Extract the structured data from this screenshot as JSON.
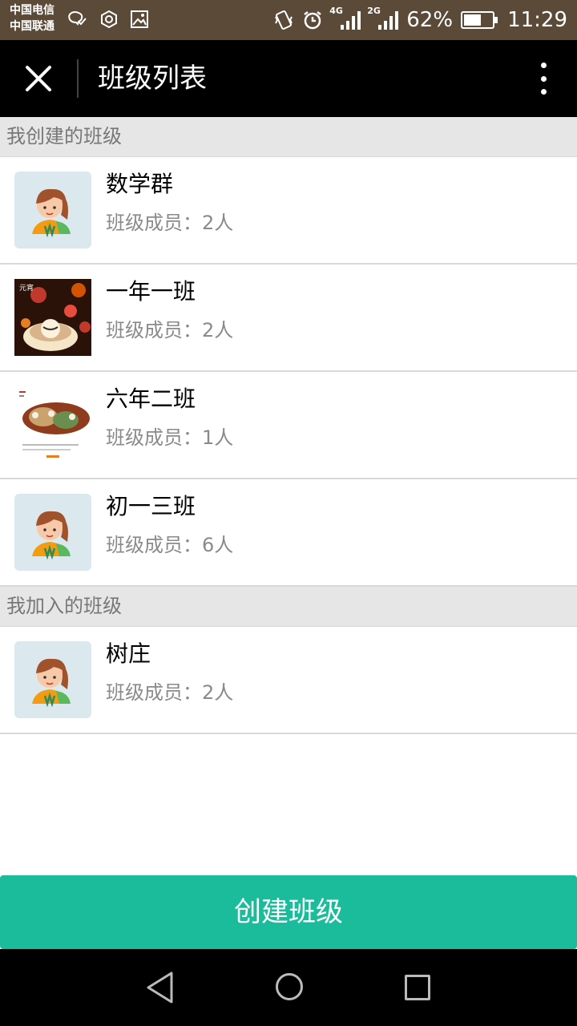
{
  "status_bar": {
    "carrier_1": "中国电信",
    "carrier_2": "中国联通",
    "net_1": "4G",
    "net_2": "2G",
    "battery": "62%",
    "battery_level": 0.62,
    "time": "11:29"
  },
  "header": {
    "title": "班级列表",
    "close_icon": "close-icon",
    "more_icon": "more-vertical-icon"
  },
  "sections": [
    {
      "title": "我创建的班级",
      "items": [
        {
          "name": "数学群",
          "members": "班级成员：2人",
          "avatar": "default-avatar"
        },
        {
          "name": "一年一班",
          "members": "班级成员：2人",
          "avatar": "photo-festive"
        },
        {
          "name": "六年二班",
          "members": "班级成员：1人",
          "avatar": "photo-poster"
        },
        {
          "name": "初一三班",
          "members": "班级成员：6人",
          "avatar": "default-avatar"
        }
      ]
    },
    {
      "title": "我加入的班级",
      "items": [
        {
          "name": "树庄",
          "members": "班级成员：2人",
          "avatar": "default-avatar"
        }
      ]
    }
  ],
  "create_button": "创建班级",
  "colors": {
    "accent": "#1abc9c",
    "status_bar": "#5b4a37",
    "title_bar": "#000000",
    "section_bg": "#e6e6e6"
  }
}
